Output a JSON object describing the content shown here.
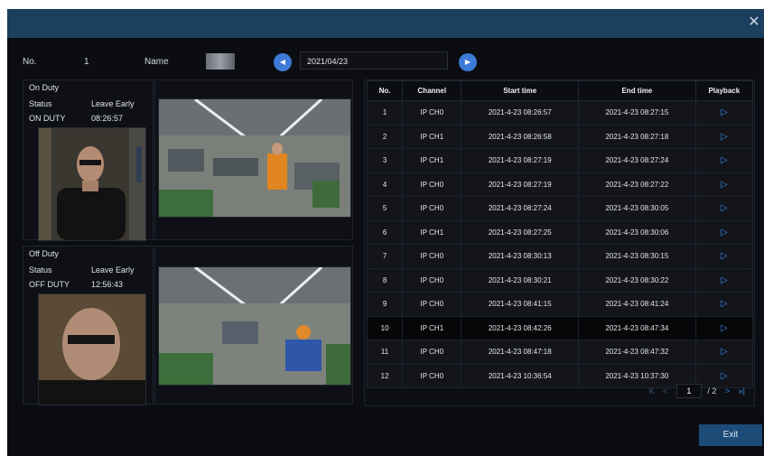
{
  "header": {
    "no_label": "No.",
    "no_value": "1",
    "name_label": "Name",
    "date": "2021/04/23"
  },
  "on_duty": {
    "title": "On Duty",
    "status_label": "Status",
    "status_value": "Leave Early",
    "duty_label": "ON DUTY",
    "time": "08:26:57"
  },
  "off_duty": {
    "title": "Off Duty",
    "status_label": "Status",
    "status_value": "Leave Early",
    "duty_label": "OFF DUTY",
    "time": "12:56:43"
  },
  "table": {
    "headers": [
      "No.",
      "Channel",
      "Start time",
      "End time",
      "Playback"
    ],
    "rows": [
      [
        "1",
        "IP CH0",
        "2021-4-23 08:26:57",
        "2021-4-23 08:27:15"
      ],
      [
        "2",
        "IP CH1",
        "2021-4-23 08:26:58",
        "2021-4-23 08:27:18"
      ],
      [
        "3",
        "IP CH1",
        "2021-4-23 08:27:19",
        "2021-4-23 08:27:24"
      ],
      [
        "4",
        "IP CH0",
        "2021-4-23 08:27:19",
        "2021-4-23 08:27:22"
      ],
      [
        "5",
        "IP CH0",
        "2021-4-23 08:27:24",
        "2021-4-23 08:30:05"
      ],
      [
        "6",
        "IP CH1",
        "2021-4-23 08:27:25",
        "2021-4-23 08:30:06"
      ],
      [
        "7",
        "IP CH0",
        "2021-4-23 08:30:13",
        "2021-4-23 08:30:15"
      ],
      [
        "8",
        "IP CH0",
        "2021-4-23 08:30:21",
        "2021-4-23 08:30:22"
      ],
      [
        "9",
        "IP CH0",
        "2021-4-23 08:41:15",
        "2021-4-23 08:41:24"
      ],
      [
        "10",
        "IP CH1",
        "2021-4-23 08:42:26",
        "2021-4-23 08:47:34"
      ],
      [
        "11",
        "IP CH0",
        "2021-4-23 08:47:18",
        "2021-4-23 08:47:32"
      ],
      [
        "12",
        "IP CH0",
        "2021-4-23 10:36:54",
        "2021-4-23 10:37:30"
      ]
    ],
    "selected_row": 10
  },
  "pager": {
    "first": "K",
    "prev": "<",
    "current": "1",
    "total": "/ 2",
    "next": ">",
    "last": "»|"
  },
  "exit_label": "Exit",
  "icons": {
    "close": "close-icon",
    "prev": "chevron-left-icon",
    "next": "chevron-right-icon",
    "play": "play-icon"
  },
  "colors": {
    "titlebar": "#1b3f5e",
    "accent": "#3a8ce6",
    "exit": "#1d4b78"
  }
}
